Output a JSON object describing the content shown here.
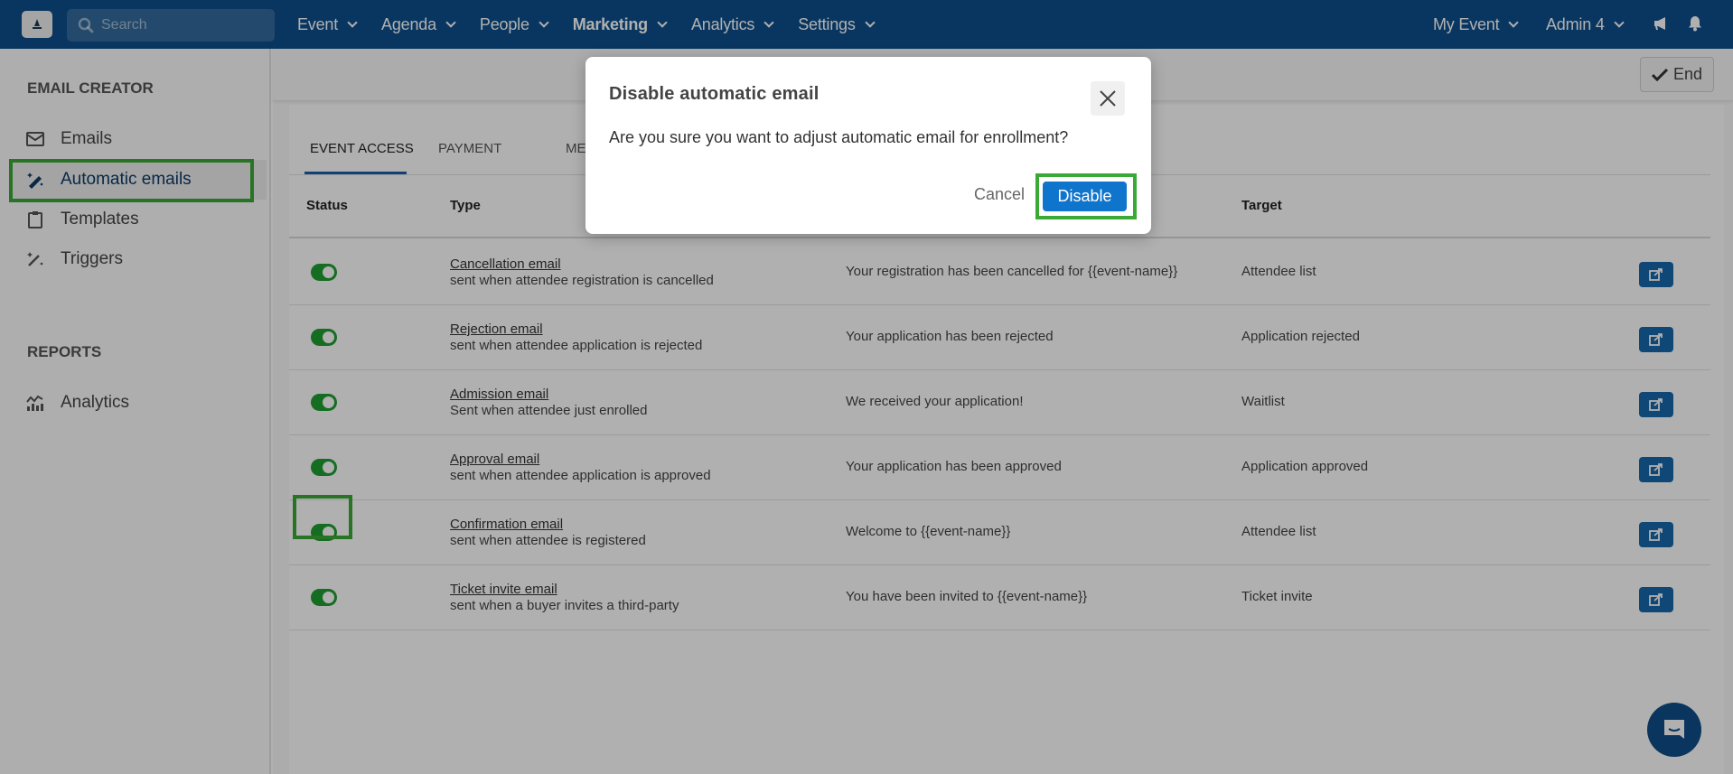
{
  "navbar": {
    "search_placeholder": "Search",
    "menu": [
      {
        "label": "Event",
        "bold": false
      },
      {
        "label": "Agenda",
        "bold": false
      },
      {
        "label": "People",
        "bold": false
      },
      {
        "label": "Marketing",
        "bold": true
      },
      {
        "label": "Analytics",
        "bold": false
      },
      {
        "label": "Settings",
        "bold": false
      }
    ],
    "event_selector": "My Event",
    "user_menu": "Admin 4",
    "icons": [
      "megaphone-icon",
      "bell-icon"
    ]
  },
  "sidebar": {
    "section1_heading": "EMAIL CREATOR",
    "items": [
      {
        "label": "Emails",
        "icon": "envelope-icon",
        "active": false
      },
      {
        "label": "Automatic emails",
        "icon": "magic-wand-icon",
        "active": true
      },
      {
        "label": "Templates",
        "icon": "clipboard-icon",
        "active": false
      },
      {
        "label": "Triggers",
        "icon": "wand-sparkle-icon",
        "active": false
      }
    ],
    "section2_heading": "REPORTS",
    "report_items": [
      {
        "label": "Analytics",
        "icon": "chart-icon"
      }
    ]
  },
  "toolbar": {
    "end_label": "End"
  },
  "tabs": [
    {
      "label": "EVENT ACCESS",
      "active": true
    },
    {
      "label": "PAYMENT",
      "active": false
    },
    {
      "label": "ME",
      "active": false
    }
  ],
  "table": {
    "headers": {
      "status": "Status",
      "type": "Type",
      "target": "Target"
    },
    "rows": [
      {
        "enabled": true,
        "name": "Cancellation email",
        "desc": "sent when attendee registration is cancelled",
        "subject": "Your registration has been cancelled for {{event-name}}",
        "target": "Attendee list"
      },
      {
        "enabled": true,
        "name": "Rejection email",
        "desc": "sent when attendee application is rejected",
        "subject": "Your application has been rejected",
        "target": "Application rejected"
      },
      {
        "enabled": true,
        "name": "Admission email",
        "desc": "Sent when attendee just enrolled",
        "subject": "We received your application!",
        "target": "Waitlist"
      },
      {
        "enabled": true,
        "name": "Approval email",
        "desc": "sent when attendee application is approved",
        "subject": "Your application has been approved",
        "target": "Application approved"
      },
      {
        "enabled": true,
        "name": "Confirmation email",
        "desc": "sent when attendee is registered",
        "subject": "Welcome to {{event-name}}",
        "target": "Attendee list"
      },
      {
        "enabled": true,
        "name": "Ticket invite email",
        "desc": "sent when a buyer invites a third-party",
        "subject": "You have been invited to {{event-name}}",
        "target": "Ticket invite"
      }
    ]
  },
  "modal": {
    "title": "Disable automatic email",
    "body": "Are you sure you want to adjust automatic email for enrollment?",
    "cancel_label": "Cancel",
    "confirm_label": "Disable"
  },
  "colors": {
    "navbar": "#0d4f8b",
    "toggle_on": "#1d9e2f",
    "primary_button": "#0f74cc",
    "edit_button": "#1767ad",
    "highlight": "#3aa935"
  }
}
